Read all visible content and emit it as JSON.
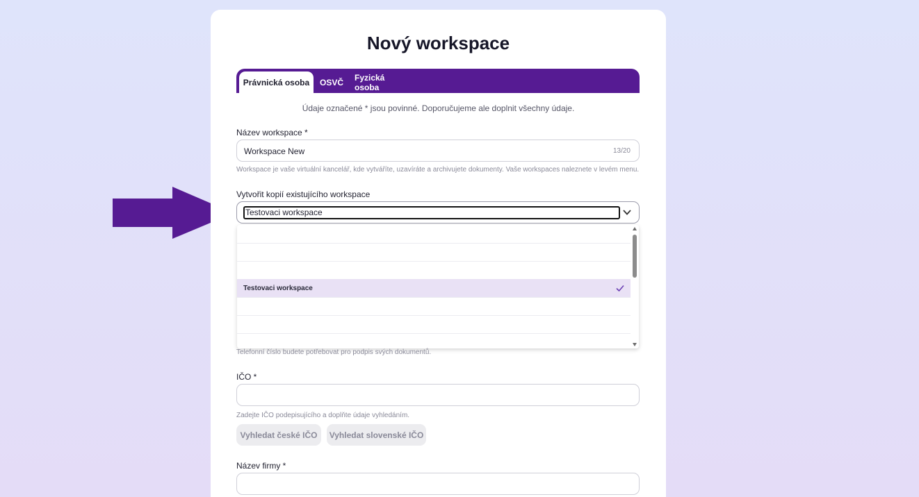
{
  "page": {
    "title": "Nový workspace",
    "note": "Údaje označené * jsou povinné. Doporučujeme ale doplnit všechny údaje."
  },
  "tabs": [
    {
      "label": "Právnická osoba",
      "active": true
    },
    {
      "label": "OSVČ",
      "active": false
    },
    {
      "label": "Fyzická osoba",
      "active": false
    }
  ],
  "workspace_name": {
    "label": "Název workspace *",
    "value": "Workspace New",
    "counter": "13/20",
    "help": "Workspace je vaše virtuální kancelář, kde vytváříte, uzavíráte a archivujete dokumenty. Vaše workspaces naleznete v levém menu."
  },
  "copy_workspace": {
    "label": "Vytvořit kopií existujícího workspace",
    "value": "Testovaci workspace",
    "options": [
      "",
      "",
      "",
      "Testovaci workspace",
      "",
      "",
      ""
    ],
    "selected_index": 3
  },
  "phone": {
    "help": "Telefonní číslo budete potřebovat pro podpis svých dokumentů."
  },
  "ico": {
    "label": "IČO *",
    "value": "",
    "help": "Zadejte IČO podepisujícího a doplňte údaje vyhledáním.",
    "search_cz": "Vyhledat české IČO",
    "search_sk": "Vyhledat slovenské IČO"
  },
  "company_name": {
    "label": "Název firmy *",
    "value": ""
  },
  "colors": {
    "accent": "#561b93",
    "annotation_arrow": "#561b93",
    "selected_option_bg": "#e9e1f5"
  }
}
